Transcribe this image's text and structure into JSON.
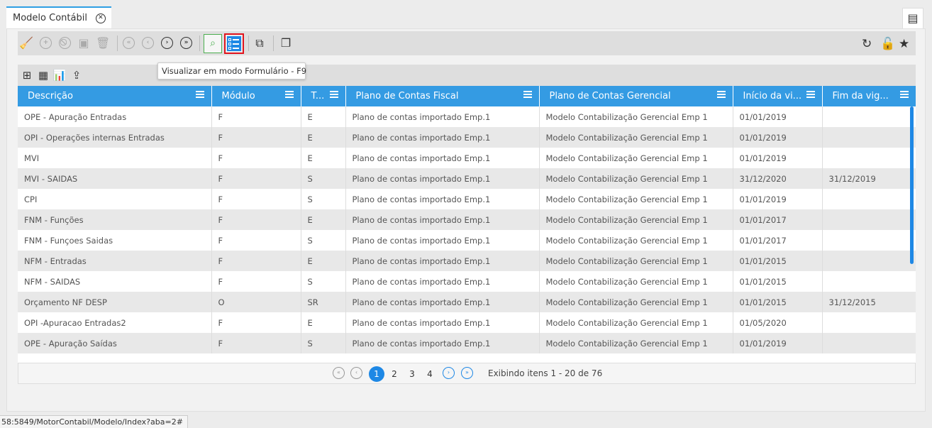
{
  "tab": {
    "title": "Modelo Contábil"
  },
  "tooltip": {
    "text": "Visualizar em modo Formulário - F9"
  },
  "table": {
    "columns": [
      "Descrição",
      "Módulo",
      "T...",
      "Plano de Contas Fiscal",
      "Plano de Contas Gerencial",
      "Início da vi...",
      "Fim da vig..."
    ],
    "rows": [
      [
        "OPE - Apuração Entradas",
        "F",
        "E",
        "Plano de contas importado Emp.1",
        "Modelo Contabilização Gerencial Emp 1",
        "01/01/2019",
        ""
      ],
      [
        "OPI - Operações internas Entradas",
        "F",
        "E",
        "Plano de contas importado Emp.1",
        "Modelo Contabilização Gerencial Emp 1",
        "01/01/2019",
        ""
      ],
      [
        "MVI",
        "F",
        "E",
        "Plano de contas importado Emp.1",
        "Modelo Contabilização Gerencial Emp 1",
        "01/01/2019",
        ""
      ],
      [
        "MVI - SAIDAS",
        "F",
        "S",
        "Plano de contas importado Emp.1",
        "Modelo Contabilização Gerencial Emp 1",
        "31/12/2020",
        "31/12/2019"
      ],
      [
        "CPI",
        "F",
        "S",
        "Plano de contas importado Emp.1",
        "Modelo Contabilização Gerencial Emp 1",
        "01/01/2019",
        ""
      ],
      [
        "FNM - Funções",
        "F",
        "E",
        "Plano de contas importado Emp.1",
        "Modelo Contabilização Gerencial Emp 1",
        "01/01/2017",
        ""
      ],
      [
        "FNM - Funçoes Saidas",
        "F",
        "S",
        "Plano de contas importado Emp.1",
        "Modelo Contabilização Gerencial Emp 1",
        "01/01/2017",
        ""
      ],
      [
        "NFM - Entradas",
        "F",
        "E",
        "Plano de contas importado Emp.1",
        "Modelo Contabilização Gerencial Emp 1",
        "01/01/2015",
        ""
      ],
      [
        "NFM - SAIDAS",
        "F",
        "S",
        "Plano de contas importado Emp.1",
        "Modelo Contabilização Gerencial Emp 1",
        "01/01/2015",
        ""
      ],
      [
        "Orçamento NF DESP",
        "O",
        "SR",
        "Plano de contas importado Emp.1",
        "Modelo Contabilização Gerencial Emp 1",
        "01/01/2015",
        "31/12/2015"
      ],
      [
        "OPI -Apuracao Entradas2",
        "F",
        "E",
        "Plano de contas importado Emp.1",
        "Modelo Contabilização Gerencial Emp 1",
        "01/05/2020",
        ""
      ],
      [
        "OPE - Apuração Saídas",
        "F",
        "S",
        "Plano de contas importado Emp.1",
        "Modelo Contabilização Gerencial Emp 1",
        "01/01/2019",
        ""
      ]
    ]
  },
  "pager": {
    "pages": [
      "1",
      "2",
      "3",
      "4"
    ],
    "info": "Exibindo itens 1 - 20 de 76"
  },
  "status": {
    "url": "58:5849/MotorContabil/Modelo/Index?aba=2#"
  }
}
